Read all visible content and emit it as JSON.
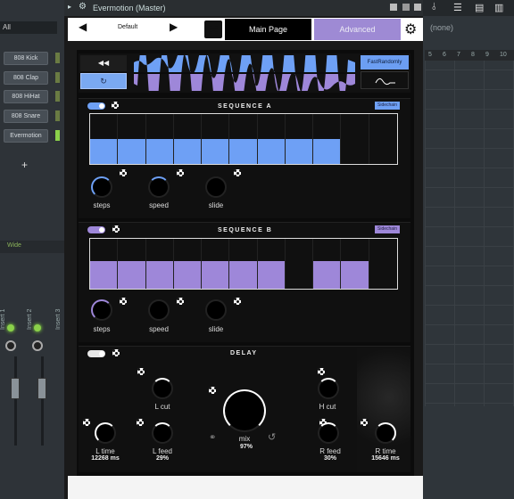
{
  "host": {
    "left_dropdown": "All",
    "channels": [
      "808 Kick",
      "808 Clap",
      "808 HiHat",
      "808 Snare",
      "Evermotion"
    ],
    "mixer_label": "Wide",
    "insert_labels": [
      "Insert 1",
      "Insert 2",
      "Insert 3"
    ],
    "right_none": "(none)",
    "ruler": [
      "5",
      "6",
      "7",
      "8",
      "9",
      "10"
    ]
  },
  "window": {
    "title": "Evermotion (Master)",
    "preset": "Default",
    "tab_main": "Main Page",
    "tab_advanced": "Advanced"
  },
  "wave": {
    "btn_rewind": "◀◀",
    "mode_a": "FastRandomly"
  },
  "sequence_a": {
    "title": "SEQUENCE A",
    "badge": "Sidechain",
    "color": "#6ea0f5",
    "step_levels": [
      0.5,
      0.5,
      0.5,
      0.5,
      0.5,
      0.5,
      0.5,
      0.5,
      0.5,
      0,
      0
    ],
    "knobs": [
      "steps",
      "speed",
      "slide"
    ]
  },
  "sequence_b": {
    "title": "SEQUENCE B",
    "badge": "Sidechain",
    "color": "#9e87d9",
    "step_levels": [
      0.55,
      0.55,
      0.55,
      0.55,
      0.55,
      0.55,
      0.55,
      0,
      0.55,
      0.55,
      0
    ],
    "knobs": [
      "steps",
      "speed",
      "slide"
    ]
  },
  "delay": {
    "title": "DELAY",
    "lcut": "L cut",
    "hcut": "H cut",
    "ltime": "L time",
    "ltime_val": "12268 ms",
    "lfeed": "L feed",
    "lfeed_val": "29%",
    "mix": "mix",
    "mix_val": "97%",
    "rfeed": "R feed",
    "rfeed_val": "30%",
    "rtime": "R time",
    "rtime_val": "15646 ms"
  }
}
